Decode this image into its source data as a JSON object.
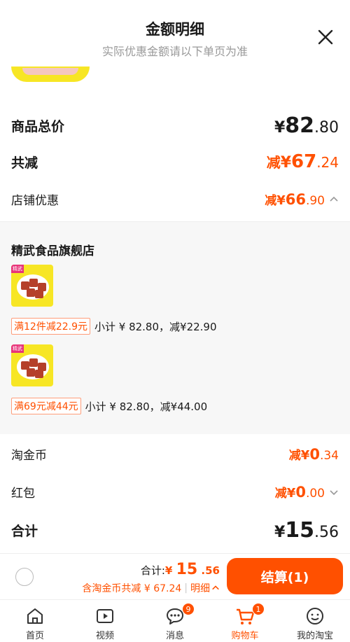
{
  "header": {
    "title": "金额明细",
    "subtitle": "实际优惠金额请以下单页为准"
  },
  "summary": {
    "goods_total_label": "商品总价",
    "goods_total": {
      "cur": "¥",
      "int": "82",
      "dec": ".80"
    },
    "total_discount_label": "共减",
    "total_discount": {
      "pre": "减",
      "cur": "¥",
      "int": "67",
      "dec": ".24"
    },
    "shop_discount_label": "店铺优惠",
    "shop_discount": {
      "pre": "减",
      "cur": "¥",
      "int": "66",
      "dec": ".90"
    }
  },
  "store": {
    "name": "精武食品旗舰店",
    "promos": [
      {
        "img_tag": "精武",
        "tag": "满12件减22.9元",
        "text": "小计 ¥ 82.80，减¥22.90"
      },
      {
        "img_tag": "精武",
        "tag": "满69元减44元",
        "text": "小计 ¥ 82.80，减¥44.00"
      }
    ]
  },
  "extras": {
    "coins_label": "淘金币",
    "coins": {
      "pre": "减",
      "cur": "¥",
      "int": "0",
      "dec": ".34"
    },
    "redpacket_label": "红包",
    "redpacket": {
      "pre": "减",
      "cur": "¥",
      "int": "0",
      "dec": ".00"
    },
    "total_label": "合计",
    "total": {
      "cur": "¥",
      "int": "15",
      "dec": ".56"
    }
  },
  "checkout": {
    "total_prefix": "合计:",
    "total": {
      "cur": "¥",
      "int": "15",
      "dec": ".56"
    },
    "discount_text": "含淘金币共减 ¥ 67.24",
    "detail_label": "明细",
    "button_label": "结算(1)"
  },
  "tabs": [
    {
      "label": "首页",
      "icon": "home-icon"
    },
    {
      "label": "视频",
      "icon": "video-icon"
    },
    {
      "label": "消息",
      "icon": "message-icon",
      "badge": "9"
    },
    {
      "label": "购物车",
      "icon": "cart-icon",
      "badge": "1",
      "active": true
    },
    {
      "label": "我的淘宝",
      "icon": "profile-icon"
    }
  ],
  "colors": {
    "accent": "#ff5000",
    "badge": "#ff5000"
  }
}
